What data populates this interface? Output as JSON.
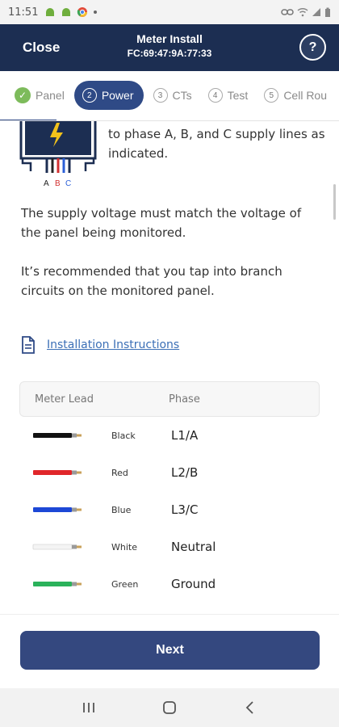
{
  "status": {
    "time": "11:51",
    "icons": [
      "android-icon",
      "android-icon",
      "chrome-icon",
      "dot-icon"
    ],
    "right_icons": [
      "link-icon",
      "wifi-icon",
      "signal-icon",
      "battery-icon"
    ]
  },
  "header": {
    "close_label": "Close",
    "title": "Meter Install",
    "subtitle": "FC:69:47:9A:77:33",
    "help_label": "?"
  },
  "steps": [
    {
      "label": "Panel",
      "num": "",
      "state": "done"
    },
    {
      "label": "Power",
      "num": "2",
      "state": "active"
    },
    {
      "label": "CTs",
      "num": "3",
      "state": "pending"
    },
    {
      "label": "Test",
      "num": "4",
      "state": "pending"
    },
    {
      "label": "Cell Rou",
      "num": "5",
      "state": "pending"
    }
  ],
  "illustration": {
    "phase_labels": [
      "A",
      "B",
      "C"
    ],
    "colors": {
      "a": "#222222",
      "b": "#d23030",
      "c": "#2b5fd8",
      "bolt": "#f2c21b",
      "frame": "#1c2e52"
    }
  },
  "content": {
    "phase_text": "to phase A, B, and C supply lines as indicated.",
    "voltage_text": "The supply voltage must match the voltage of the panel being  monitored.",
    "branch_text": "It’s recommended that you tap into branch circuits on the monitored panel.",
    "instructions_link": "Installation Instructions"
  },
  "lead_table": {
    "headers": {
      "lead": "Meter Lead",
      "phase": "Phase"
    },
    "rows": [
      {
        "color_name": "Black",
        "phase": "L1/A",
        "hex": "#111111"
      },
      {
        "color_name": "Red",
        "phase": "L2/B",
        "hex": "#e0262a"
      },
      {
        "color_name": "Blue",
        "phase": "L3/C",
        "hex": "#1d48d6"
      },
      {
        "color_name": "White",
        "phase": "Neutral",
        "hex": "#f4f4f4"
      },
      {
        "color_name": "Green",
        "phase": "Ground",
        "hex": "#2bb25b"
      }
    ]
  },
  "footer": {
    "next_label": "Next"
  },
  "navbar": {
    "icons": [
      "recents-icon",
      "home-icon",
      "back-icon"
    ]
  },
  "theme": {
    "header_bg": "#1c2e52",
    "accent": "#34487f",
    "link": "#3b6fb6",
    "success": "#7dbb5b"
  }
}
